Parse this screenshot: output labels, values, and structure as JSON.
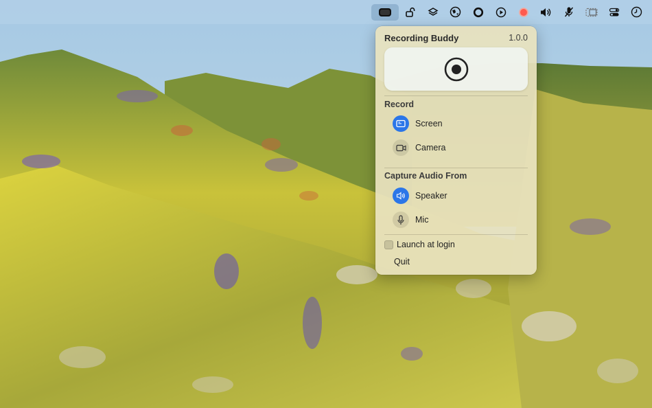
{
  "menubar": {
    "items": [
      {
        "icon": "screen-record-icon",
        "active": true
      },
      {
        "icon": "unlock-icon"
      },
      {
        "icon": "layers-icon"
      },
      {
        "icon": "globe-icon"
      },
      {
        "icon": "circle-ring-icon"
      },
      {
        "icon": "play-circle-icon"
      },
      {
        "icon": "record-dot-icon"
      },
      {
        "icon": "volume-icon"
      },
      {
        "icon": "mic-off-icon"
      },
      {
        "icon": "sidebar-icon"
      },
      {
        "icon": "control-center-icon"
      },
      {
        "icon": "clock-icon"
      }
    ]
  },
  "panel": {
    "title": "Recording Buddy",
    "version": "1.0.0",
    "record_section": "Record",
    "record_options": [
      {
        "label": "Screen",
        "icon": "screen-icon",
        "selected": true
      },
      {
        "label": "Camera",
        "icon": "camera-icon",
        "selected": false
      }
    ],
    "audio_section": "Capture Audio From",
    "audio_options": [
      {
        "label": "Speaker",
        "icon": "speaker-icon",
        "selected": true
      },
      {
        "label": "Mic",
        "icon": "microphone-icon",
        "selected": false
      }
    ],
    "launch_at_login": {
      "label": "Launch at login",
      "checked": false
    },
    "quit_label": "Quit"
  },
  "colors": {
    "accent": "#2b76e8",
    "panel_bg": "#e8e2be",
    "record_indicator": "#ff5a4e"
  }
}
